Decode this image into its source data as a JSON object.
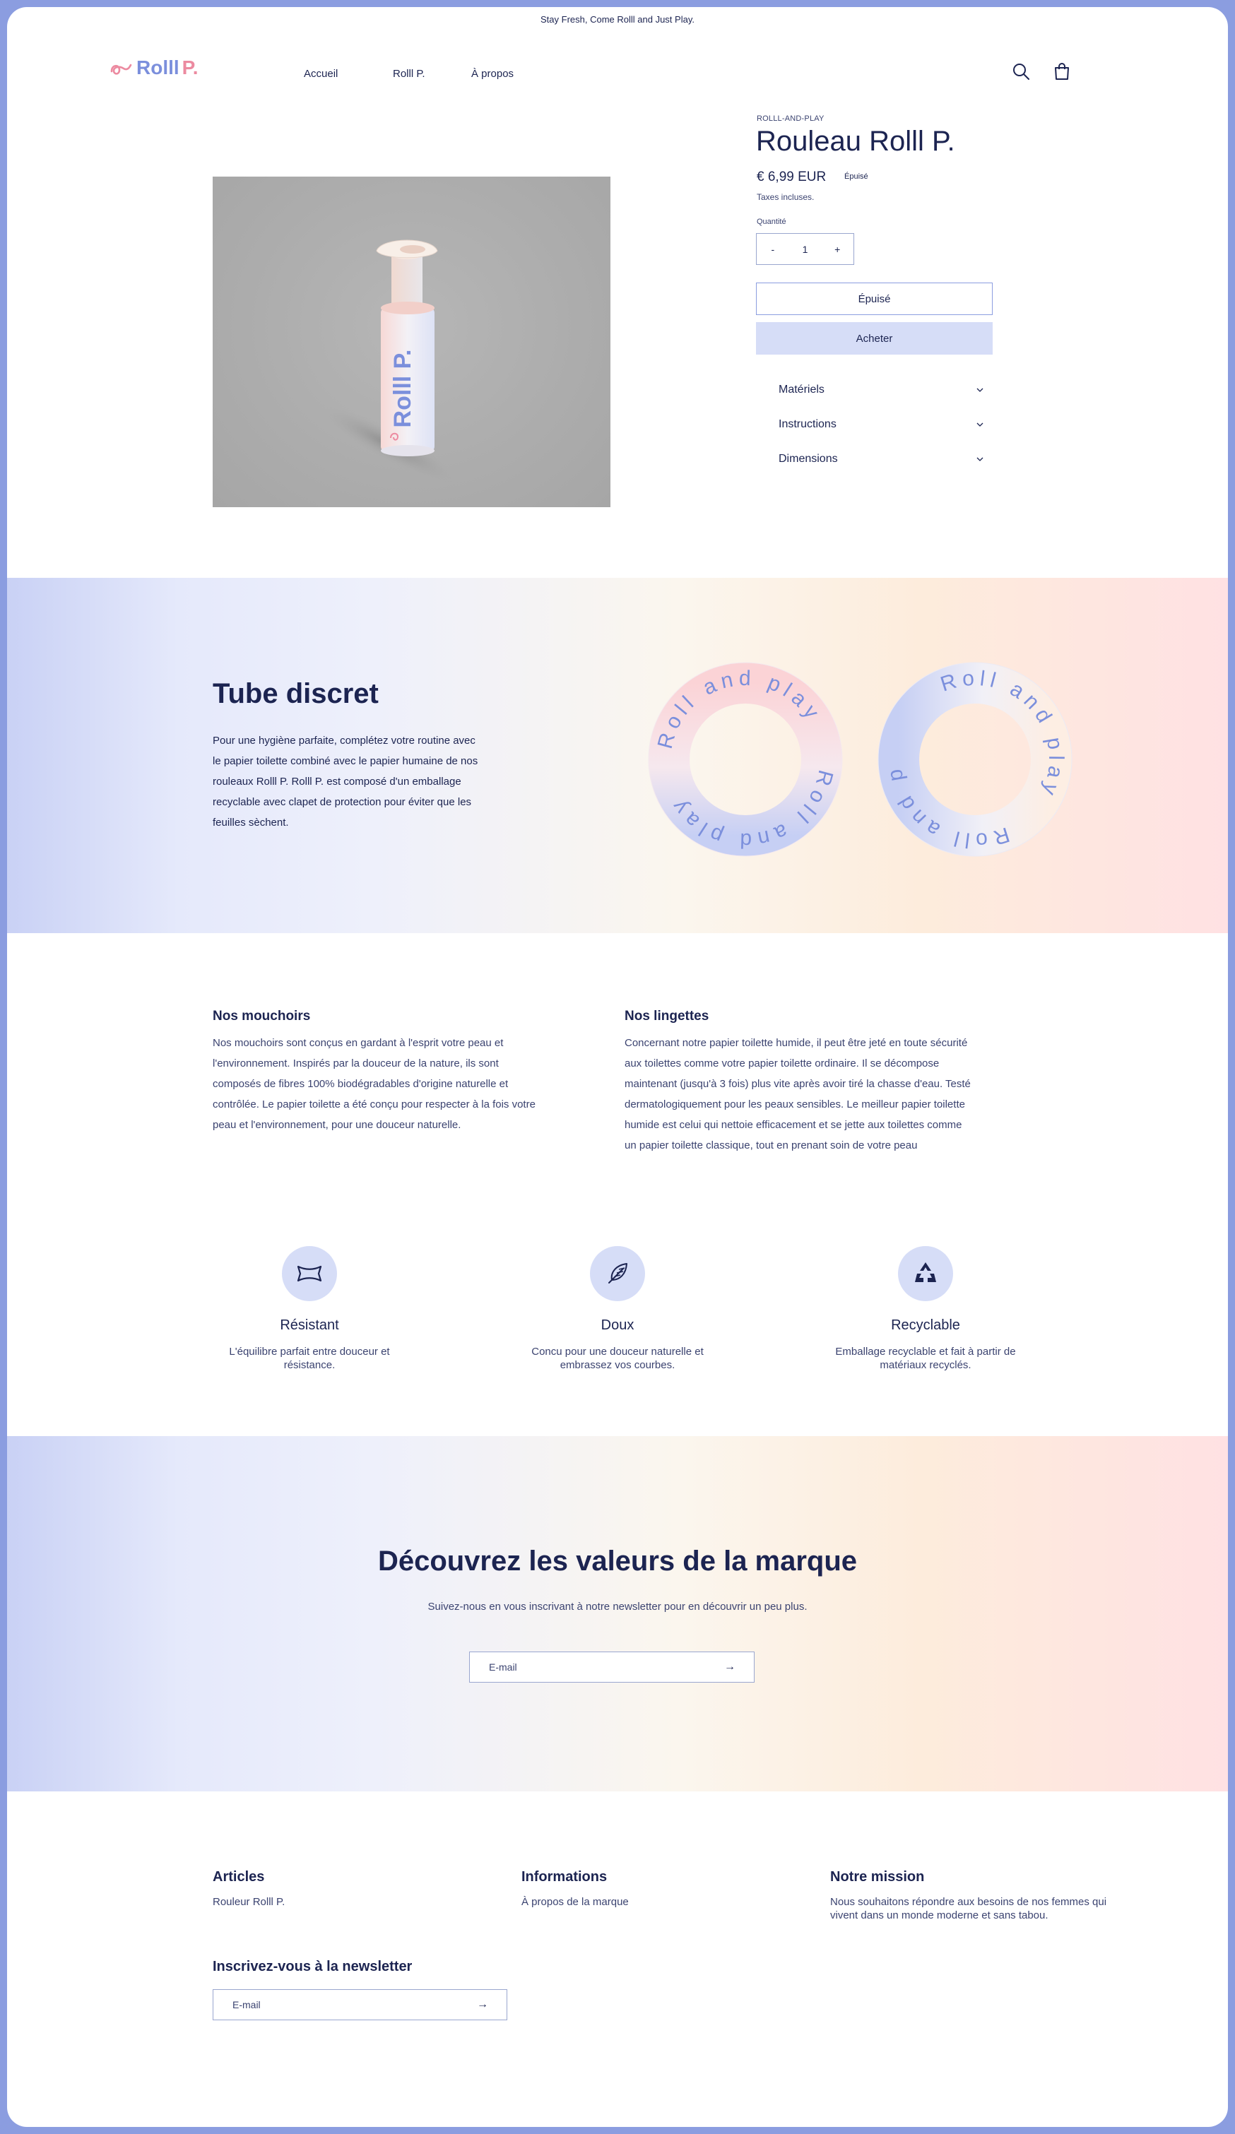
{
  "announcement": "Stay Fresh, Come Rolll and Just Play.",
  "header": {
    "logo_text": "Rolll",
    "logo_suffix": "P.",
    "nav": [
      "Accueil",
      "Rolll P.",
      "À propos"
    ],
    "icons": [
      "search-icon",
      "cart-icon"
    ]
  },
  "product": {
    "vendor": "ROLLL-AND-PLAY",
    "title": "Rouleau Rolll P.",
    "price": "€ 6,99 EUR",
    "badge": "Épuisé",
    "tax_note": "Taxes incluses.",
    "quantity_label": "Quantité",
    "quantity": "1",
    "minus": "-",
    "plus": "+",
    "sold_out_button": "Épuisé",
    "buy_button": "Acheter",
    "accordion": [
      "Matériels",
      "Instructions",
      "Dimensions"
    ],
    "image_label": "Rolll P."
  },
  "tube": {
    "title": "Tube discret",
    "text": "Pour une hygiène parfaite, complétez votre routine avec le papier toilette combiné avec le papier humaine de nos rouleaux Rolll P. Rolll P. est composé d'un emballage recyclable avec clapet de protection pour éviter que les feuilles sèchent.",
    "ring_text": "Roll and play"
  },
  "columns": [
    {
      "title": "Nos mouchoirs",
      "text": "Nos mouchoirs sont conçus en gardant à l'esprit votre peau et l'environnement. Inspirés par la douceur de la nature, ils sont composés de fibres 100% biodégradables d'origine naturelle et contrôlée. Le papier toilette a été conçu pour respecter à la fois votre peau et l'environnement, pour une douceur naturelle."
    },
    {
      "title": "Nos lingettes",
      "text": "Concernant notre papier toilette humide, il peut être jeté en toute sécurité aux toilettes comme votre papier toilette ordinaire. Il se décompose maintenant (jusqu'à 3 fois) plus vite après avoir tiré la chasse d'eau. Testé dermatologiquement pour les peaux sensibles. Le meilleur papier toilette humide est celui qui nettoie efficacement et se jette aux toilettes comme un papier toilette classique, tout en prenant soin de votre peau"
    }
  ],
  "features": [
    {
      "icon": "tissue-icon",
      "title": "Résistant",
      "text": "L'équilibre parfait entre douceur et résistance."
    },
    {
      "icon": "feather-icon",
      "title": "Doux",
      "text": "Concu pour une douceur naturelle et embrassez vos courbes."
    },
    {
      "icon": "recycle-icon",
      "title": "Recyclable",
      "text": "Emballage recyclable et fait à partir de matériaux recyclés."
    }
  ],
  "newsletter": {
    "title": "Découvrez les valeurs de la marque",
    "subtitle": "Suivez-nous en vous inscrivant à notre newsletter pour en découvrir un peu plus.",
    "placeholder": "E-mail",
    "arrow": "→"
  },
  "footer": {
    "articles_title": "Articles",
    "articles_link": "Rouleur Rolll P.",
    "info_title": "Informations",
    "info_link": "À propos de la marque",
    "mission_title": "Notre mission",
    "mission_text": "Nous souhaitons répondre aux besoins de nos femmes qui vivent dans un monde moderne et sans tabou.",
    "newsletter_title": "Inscrivez-vous à la newsletter",
    "placeholder": "E-mail",
    "arrow": "→"
  },
  "colors": {
    "frame": "#8b9de0",
    "navy": "#1c2451",
    "accent_blue": "#7b8fdc",
    "accent_pink": "#ec8aa0",
    "button_fill": "#d6ddf7"
  }
}
